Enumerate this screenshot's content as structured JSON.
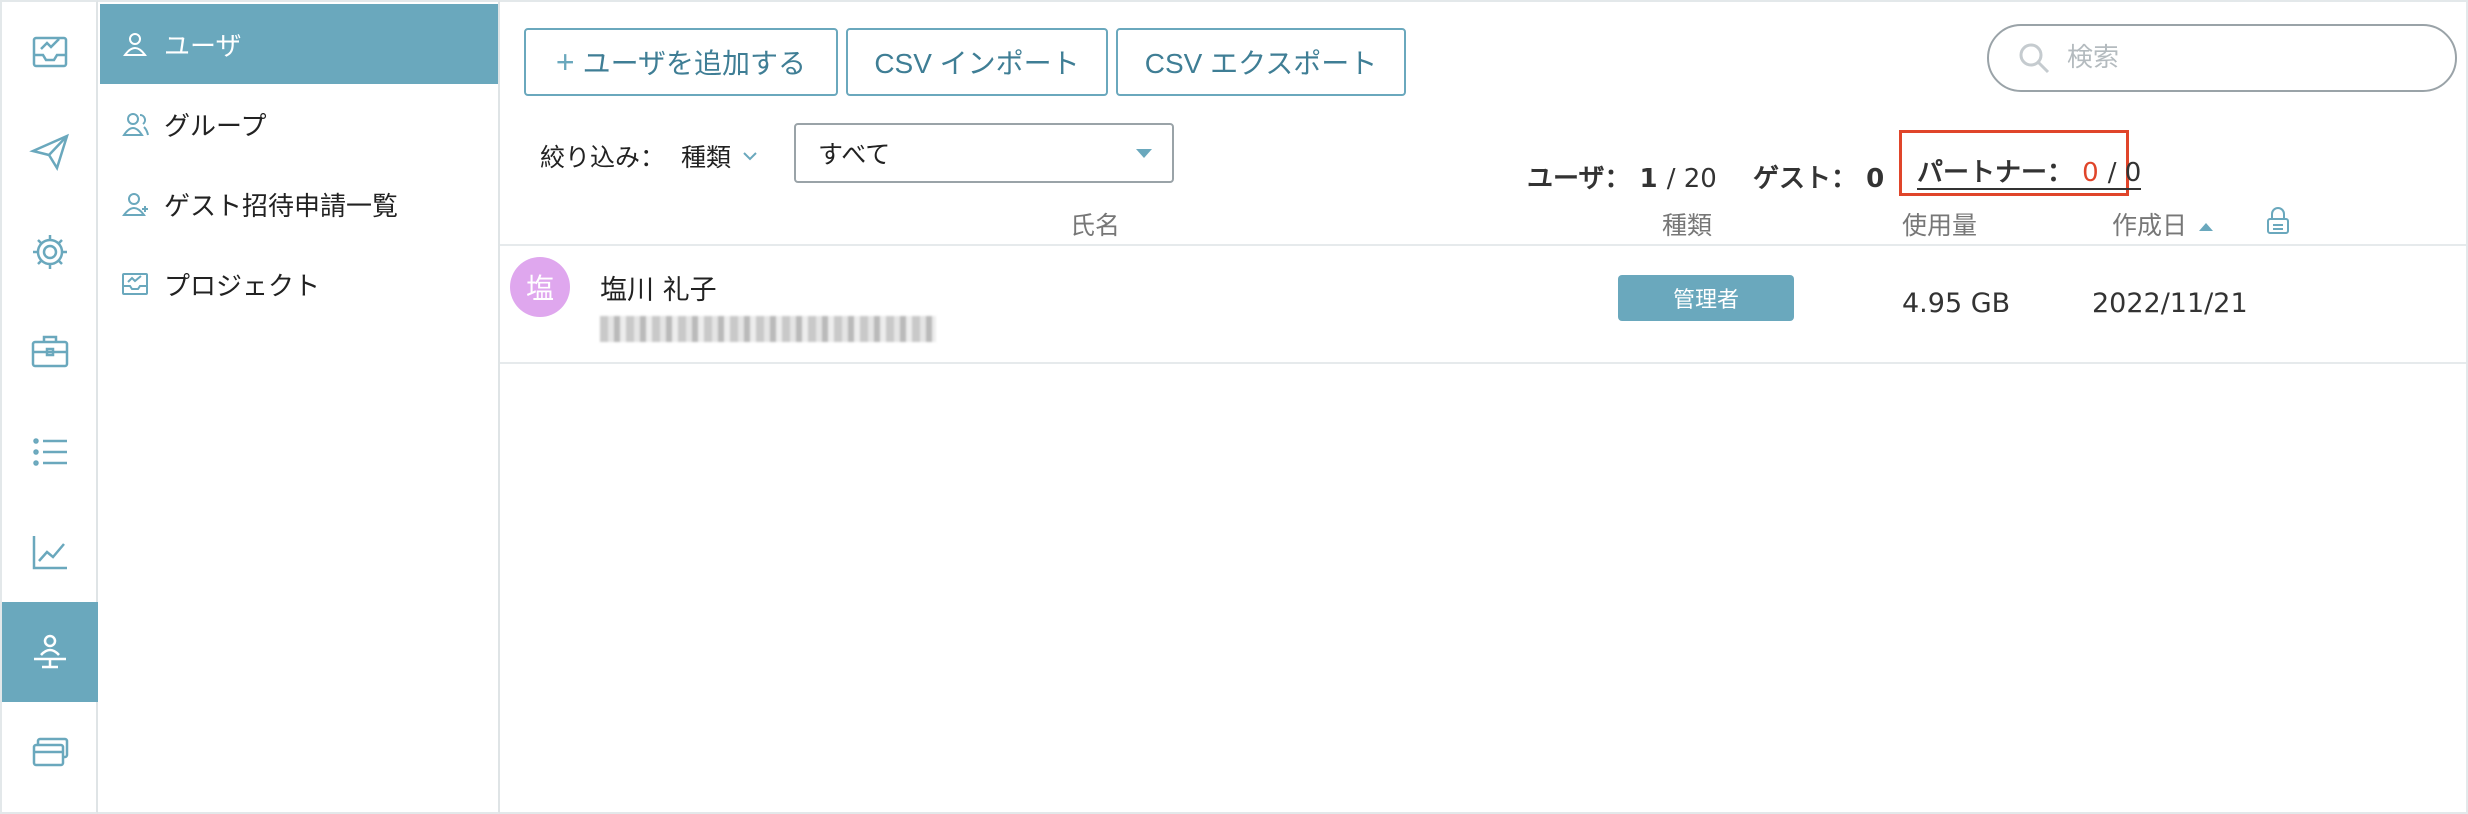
{
  "sidebar": {
    "active_index": 6,
    "icons": [
      "inbox-icon",
      "send-icon",
      "gear-icon",
      "briefcase-icon",
      "list-icon",
      "chart-icon",
      "user-org-icon",
      "cards-icon"
    ]
  },
  "subnav": {
    "items": [
      {
        "label": "ユーザ",
        "icon": "user-icon",
        "active": true
      },
      {
        "label": "グループ",
        "icon": "group-icon",
        "active": false
      },
      {
        "label": "ゲスト招待申請一覧",
        "icon": "guest-icon",
        "active": false
      },
      {
        "label": "プロジェクト",
        "icon": "project-icon",
        "active": false
      }
    ]
  },
  "toolbar": {
    "add_user_label": "ユーザを追加する",
    "csv_import_label": "CSV インポート",
    "csv_export_label": "CSV エクスポート"
  },
  "search": {
    "placeholder": "検索",
    "value": ""
  },
  "filter": {
    "label": "絞り込み：",
    "kind_label": "種類",
    "selected": "すべて"
  },
  "stats": {
    "users_label": "ユーザ：",
    "users_value": "1",
    "users_limit": "/ 20",
    "guests_label": "ゲスト：",
    "guests_value": "0",
    "partners_label": "パートナー：",
    "partners_value": "0",
    "partners_limit": "/ 0"
  },
  "table": {
    "columns": {
      "name": "氏名",
      "type": "種類",
      "usage": "使用量",
      "created": "作成日"
    },
    "sort": {
      "column": "created",
      "direction": "asc"
    },
    "rows": [
      {
        "avatar_char": "塩",
        "avatar_color": "#dfa7ee",
        "name": "塩川 礼子",
        "role": "管理者",
        "usage": "4.95 GB",
        "created": "2022/11/21"
      }
    ]
  },
  "colors": {
    "accent": "#6aa8bd",
    "highlight": "#e0452a"
  }
}
